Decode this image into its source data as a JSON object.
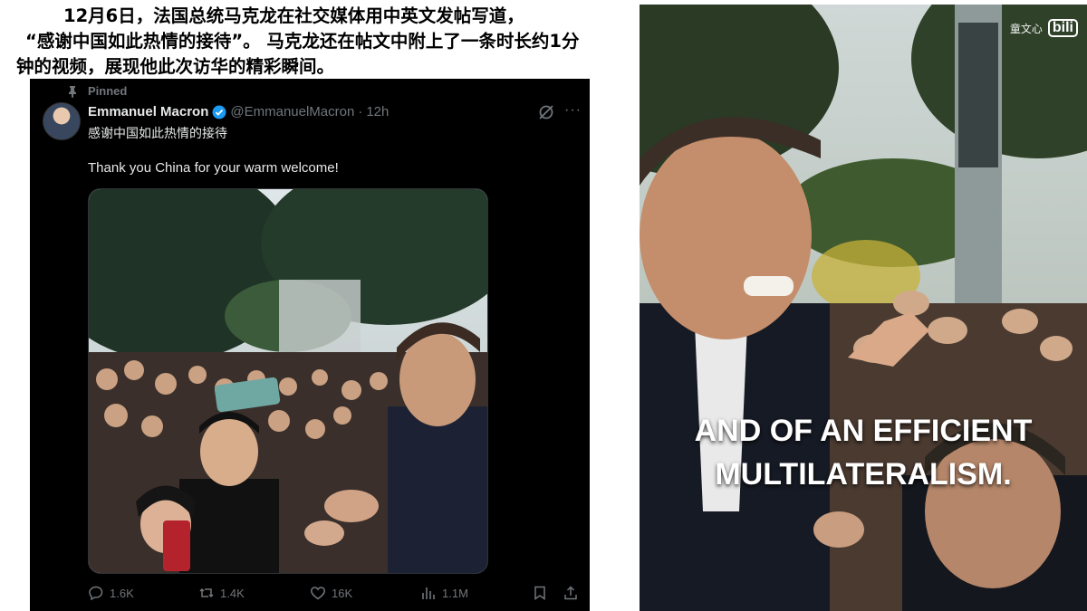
{
  "caption": {
    "line1": "12月6日，法国总统马克龙在社交媒体用中英文发帖写道，",
    "line2": "“感谢中国如此热情的接待”。 马克龙还在帖文中附上了一条时长约1分钟的视频，展现他此次访华的精彩瞬间。"
  },
  "tweet": {
    "pinned_label": "Pinned",
    "author_name": "Emmanuel Macron",
    "handle": "@EmmanuelMacron",
    "separator": "·",
    "time": "12h",
    "more_label": "···",
    "text_zh": "感谢中国如此热情的接待",
    "text_en": "Thank you China for your warm welcome!",
    "stats": {
      "replies": "1.6K",
      "reposts": "1.4K",
      "likes": "16K",
      "views": "1.1M"
    },
    "icons": [
      "pin-icon",
      "verified-icon",
      "grok-icon",
      "more-icon",
      "reply-icon",
      "repost-icon",
      "like-icon",
      "views-icon",
      "bookmark-icon",
      "share-icon"
    ]
  },
  "video": {
    "watermark_text": "童文心",
    "watermark_logo": "bili",
    "subtitle_line1": "AND OF AN EFFICIENT",
    "subtitle_line2": "MULTILATERALISM."
  },
  "colors": {
    "tweet_bg": "#000000",
    "text_primary": "#e7e9ea",
    "text_secondary": "#71767b",
    "verified_blue": "#1d9bf0"
  }
}
